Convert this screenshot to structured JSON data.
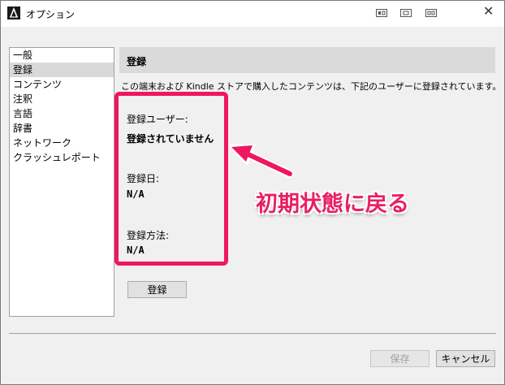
{
  "window": {
    "title": "オプション"
  },
  "sidebar": {
    "items": [
      {
        "label": "一般"
      },
      {
        "label": "登録"
      },
      {
        "label": "コンテンツ"
      },
      {
        "label": "注釈"
      },
      {
        "label": "言語"
      },
      {
        "label": "辞書"
      },
      {
        "label": "ネットワーク"
      },
      {
        "label": "クラッシュレポート"
      }
    ]
  },
  "section": {
    "title": "登録",
    "description": "この端末および Kindle ストアで購入したコンテンツは、下記のユーザーに登録されています。",
    "fields": [
      {
        "label": "登録ユーザー:",
        "value": "登録されていません"
      },
      {
        "label": "登録日:",
        "value": "N/A"
      },
      {
        "label": "登録方法:",
        "value": "N/A"
      }
    ],
    "register_button": "登録"
  },
  "annotation": {
    "text": "初期状態に戻る",
    "color": "#e91e63"
  },
  "footer": {
    "save_label": "保存",
    "cancel_label": "キャンセル"
  }
}
